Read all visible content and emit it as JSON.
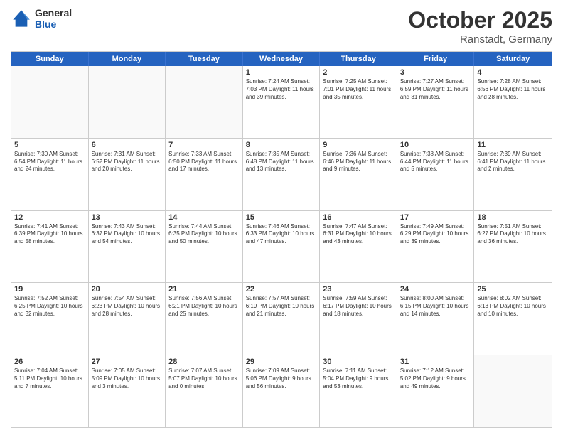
{
  "header": {
    "logo_general": "General",
    "logo_blue": "Blue",
    "month": "October 2025",
    "location": "Ranstadt, Germany"
  },
  "days_of_week": [
    "Sunday",
    "Monday",
    "Tuesday",
    "Wednesday",
    "Thursday",
    "Friday",
    "Saturday"
  ],
  "rows": [
    [
      {
        "day": "",
        "text": "",
        "empty": true
      },
      {
        "day": "",
        "text": "",
        "empty": true
      },
      {
        "day": "",
        "text": "",
        "empty": true
      },
      {
        "day": "1",
        "text": "Sunrise: 7:24 AM\nSunset: 7:03 PM\nDaylight: 11 hours\nand 39 minutes."
      },
      {
        "day": "2",
        "text": "Sunrise: 7:25 AM\nSunset: 7:01 PM\nDaylight: 11 hours\nand 35 minutes."
      },
      {
        "day": "3",
        "text": "Sunrise: 7:27 AM\nSunset: 6:59 PM\nDaylight: 11 hours\nand 31 minutes."
      },
      {
        "day": "4",
        "text": "Sunrise: 7:28 AM\nSunset: 6:56 PM\nDaylight: 11 hours\nand 28 minutes."
      }
    ],
    [
      {
        "day": "5",
        "text": "Sunrise: 7:30 AM\nSunset: 6:54 PM\nDaylight: 11 hours\nand 24 minutes."
      },
      {
        "day": "6",
        "text": "Sunrise: 7:31 AM\nSunset: 6:52 PM\nDaylight: 11 hours\nand 20 minutes."
      },
      {
        "day": "7",
        "text": "Sunrise: 7:33 AM\nSunset: 6:50 PM\nDaylight: 11 hours\nand 17 minutes."
      },
      {
        "day": "8",
        "text": "Sunrise: 7:35 AM\nSunset: 6:48 PM\nDaylight: 11 hours\nand 13 minutes."
      },
      {
        "day": "9",
        "text": "Sunrise: 7:36 AM\nSunset: 6:46 PM\nDaylight: 11 hours\nand 9 minutes."
      },
      {
        "day": "10",
        "text": "Sunrise: 7:38 AM\nSunset: 6:44 PM\nDaylight: 11 hours\nand 5 minutes."
      },
      {
        "day": "11",
        "text": "Sunrise: 7:39 AM\nSunset: 6:41 PM\nDaylight: 11 hours\nand 2 minutes."
      }
    ],
    [
      {
        "day": "12",
        "text": "Sunrise: 7:41 AM\nSunset: 6:39 PM\nDaylight: 10 hours\nand 58 minutes."
      },
      {
        "day": "13",
        "text": "Sunrise: 7:43 AM\nSunset: 6:37 PM\nDaylight: 10 hours\nand 54 minutes."
      },
      {
        "day": "14",
        "text": "Sunrise: 7:44 AM\nSunset: 6:35 PM\nDaylight: 10 hours\nand 50 minutes."
      },
      {
        "day": "15",
        "text": "Sunrise: 7:46 AM\nSunset: 6:33 PM\nDaylight: 10 hours\nand 47 minutes."
      },
      {
        "day": "16",
        "text": "Sunrise: 7:47 AM\nSunset: 6:31 PM\nDaylight: 10 hours\nand 43 minutes."
      },
      {
        "day": "17",
        "text": "Sunrise: 7:49 AM\nSunset: 6:29 PM\nDaylight: 10 hours\nand 39 minutes."
      },
      {
        "day": "18",
        "text": "Sunrise: 7:51 AM\nSunset: 6:27 PM\nDaylight: 10 hours\nand 36 minutes."
      }
    ],
    [
      {
        "day": "19",
        "text": "Sunrise: 7:52 AM\nSunset: 6:25 PM\nDaylight: 10 hours\nand 32 minutes."
      },
      {
        "day": "20",
        "text": "Sunrise: 7:54 AM\nSunset: 6:23 PM\nDaylight: 10 hours\nand 28 minutes."
      },
      {
        "day": "21",
        "text": "Sunrise: 7:56 AM\nSunset: 6:21 PM\nDaylight: 10 hours\nand 25 minutes."
      },
      {
        "day": "22",
        "text": "Sunrise: 7:57 AM\nSunset: 6:19 PM\nDaylight: 10 hours\nand 21 minutes."
      },
      {
        "day": "23",
        "text": "Sunrise: 7:59 AM\nSunset: 6:17 PM\nDaylight: 10 hours\nand 18 minutes."
      },
      {
        "day": "24",
        "text": "Sunrise: 8:00 AM\nSunset: 6:15 PM\nDaylight: 10 hours\nand 14 minutes."
      },
      {
        "day": "25",
        "text": "Sunrise: 8:02 AM\nSunset: 6:13 PM\nDaylight: 10 hours\nand 10 minutes."
      }
    ],
    [
      {
        "day": "26",
        "text": "Sunrise: 7:04 AM\nSunset: 5:11 PM\nDaylight: 10 hours\nand 7 minutes."
      },
      {
        "day": "27",
        "text": "Sunrise: 7:05 AM\nSunset: 5:09 PM\nDaylight: 10 hours\nand 3 minutes."
      },
      {
        "day": "28",
        "text": "Sunrise: 7:07 AM\nSunset: 5:07 PM\nDaylight: 10 hours\nand 0 minutes."
      },
      {
        "day": "29",
        "text": "Sunrise: 7:09 AM\nSunset: 5:06 PM\nDaylight: 9 hours\nand 56 minutes."
      },
      {
        "day": "30",
        "text": "Sunrise: 7:11 AM\nSunset: 5:04 PM\nDaylight: 9 hours\nand 53 minutes."
      },
      {
        "day": "31",
        "text": "Sunrise: 7:12 AM\nSunset: 5:02 PM\nDaylight: 9 hours\nand 49 minutes."
      },
      {
        "day": "",
        "text": "",
        "empty": true
      }
    ]
  ]
}
